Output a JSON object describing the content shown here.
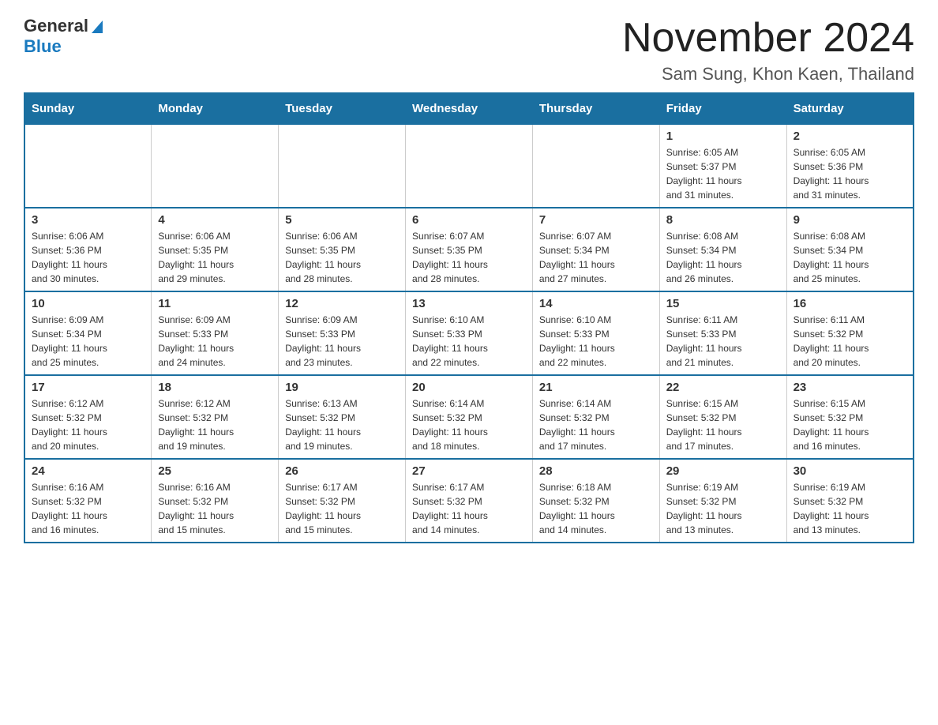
{
  "header": {
    "logo_line1": "General",
    "logo_line2": "Blue",
    "main_title": "November 2024",
    "subtitle": "Sam Sung, Khon Kaen, Thailand"
  },
  "calendar": {
    "days_of_week": [
      "Sunday",
      "Monday",
      "Tuesday",
      "Wednesday",
      "Thursday",
      "Friday",
      "Saturday"
    ],
    "weeks": [
      {
        "days": [
          {
            "num": "",
            "info": ""
          },
          {
            "num": "",
            "info": ""
          },
          {
            "num": "",
            "info": ""
          },
          {
            "num": "",
            "info": ""
          },
          {
            "num": "",
            "info": ""
          },
          {
            "num": "1",
            "info": "Sunrise: 6:05 AM\nSunset: 5:37 PM\nDaylight: 11 hours\nand 31 minutes."
          },
          {
            "num": "2",
            "info": "Sunrise: 6:05 AM\nSunset: 5:36 PM\nDaylight: 11 hours\nand 31 minutes."
          }
        ]
      },
      {
        "days": [
          {
            "num": "3",
            "info": "Sunrise: 6:06 AM\nSunset: 5:36 PM\nDaylight: 11 hours\nand 30 minutes."
          },
          {
            "num": "4",
            "info": "Sunrise: 6:06 AM\nSunset: 5:35 PM\nDaylight: 11 hours\nand 29 minutes."
          },
          {
            "num": "5",
            "info": "Sunrise: 6:06 AM\nSunset: 5:35 PM\nDaylight: 11 hours\nand 28 minutes."
          },
          {
            "num": "6",
            "info": "Sunrise: 6:07 AM\nSunset: 5:35 PM\nDaylight: 11 hours\nand 28 minutes."
          },
          {
            "num": "7",
            "info": "Sunrise: 6:07 AM\nSunset: 5:34 PM\nDaylight: 11 hours\nand 27 minutes."
          },
          {
            "num": "8",
            "info": "Sunrise: 6:08 AM\nSunset: 5:34 PM\nDaylight: 11 hours\nand 26 minutes."
          },
          {
            "num": "9",
            "info": "Sunrise: 6:08 AM\nSunset: 5:34 PM\nDaylight: 11 hours\nand 25 minutes."
          }
        ]
      },
      {
        "days": [
          {
            "num": "10",
            "info": "Sunrise: 6:09 AM\nSunset: 5:34 PM\nDaylight: 11 hours\nand 25 minutes."
          },
          {
            "num": "11",
            "info": "Sunrise: 6:09 AM\nSunset: 5:33 PM\nDaylight: 11 hours\nand 24 minutes."
          },
          {
            "num": "12",
            "info": "Sunrise: 6:09 AM\nSunset: 5:33 PM\nDaylight: 11 hours\nand 23 minutes."
          },
          {
            "num": "13",
            "info": "Sunrise: 6:10 AM\nSunset: 5:33 PM\nDaylight: 11 hours\nand 22 minutes."
          },
          {
            "num": "14",
            "info": "Sunrise: 6:10 AM\nSunset: 5:33 PM\nDaylight: 11 hours\nand 22 minutes."
          },
          {
            "num": "15",
            "info": "Sunrise: 6:11 AM\nSunset: 5:33 PM\nDaylight: 11 hours\nand 21 minutes."
          },
          {
            "num": "16",
            "info": "Sunrise: 6:11 AM\nSunset: 5:32 PM\nDaylight: 11 hours\nand 20 minutes."
          }
        ]
      },
      {
        "days": [
          {
            "num": "17",
            "info": "Sunrise: 6:12 AM\nSunset: 5:32 PM\nDaylight: 11 hours\nand 20 minutes."
          },
          {
            "num": "18",
            "info": "Sunrise: 6:12 AM\nSunset: 5:32 PM\nDaylight: 11 hours\nand 19 minutes."
          },
          {
            "num": "19",
            "info": "Sunrise: 6:13 AM\nSunset: 5:32 PM\nDaylight: 11 hours\nand 19 minutes."
          },
          {
            "num": "20",
            "info": "Sunrise: 6:14 AM\nSunset: 5:32 PM\nDaylight: 11 hours\nand 18 minutes."
          },
          {
            "num": "21",
            "info": "Sunrise: 6:14 AM\nSunset: 5:32 PM\nDaylight: 11 hours\nand 17 minutes."
          },
          {
            "num": "22",
            "info": "Sunrise: 6:15 AM\nSunset: 5:32 PM\nDaylight: 11 hours\nand 17 minutes."
          },
          {
            "num": "23",
            "info": "Sunrise: 6:15 AM\nSunset: 5:32 PM\nDaylight: 11 hours\nand 16 minutes."
          }
        ]
      },
      {
        "days": [
          {
            "num": "24",
            "info": "Sunrise: 6:16 AM\nSunset: 5:32 PM\nDaylight: 11 hours\nand 16 minutes."
          },
          {
            "num": "25",
            "info": "Sunrise: 6:16 AM\nSunset: 5:32 PM\nDaylight: 11 hours\nand 15 minutes."
          },
          {
            "num": "26",
            "info": "Sunrise: 6:17 AM\nSunset: 5:32 PM\nDaylight: 11 hours\nand 15 minutes."
          },
          {
            "num": "27",
            "info": "Sunrise: 6:17 AM\nSunset: 5:32 PM\nDaylight: 11 hours\nand 14 minutes."
          },
          {
            "num": "28",
            "info": "Sunrise: 6:18 AM\nSunset: 5:32 PM\nDaylight: 11 hours\nand 14 minutes."
          },
          {
            "num": "29",
            "info": "Sunrise: 6:19 AM\nSunset: 5:32 PM\nDaylight: 11 hours\nand 13 minutes."
          },
          {
            "num": "30",
            "info": "Sunrise: 6:19 AM\nSunset: 5:32 PM\nDaylight: 11 hours\nand 13 minutes."
          }
        ]
      }
    ]
  }
}
